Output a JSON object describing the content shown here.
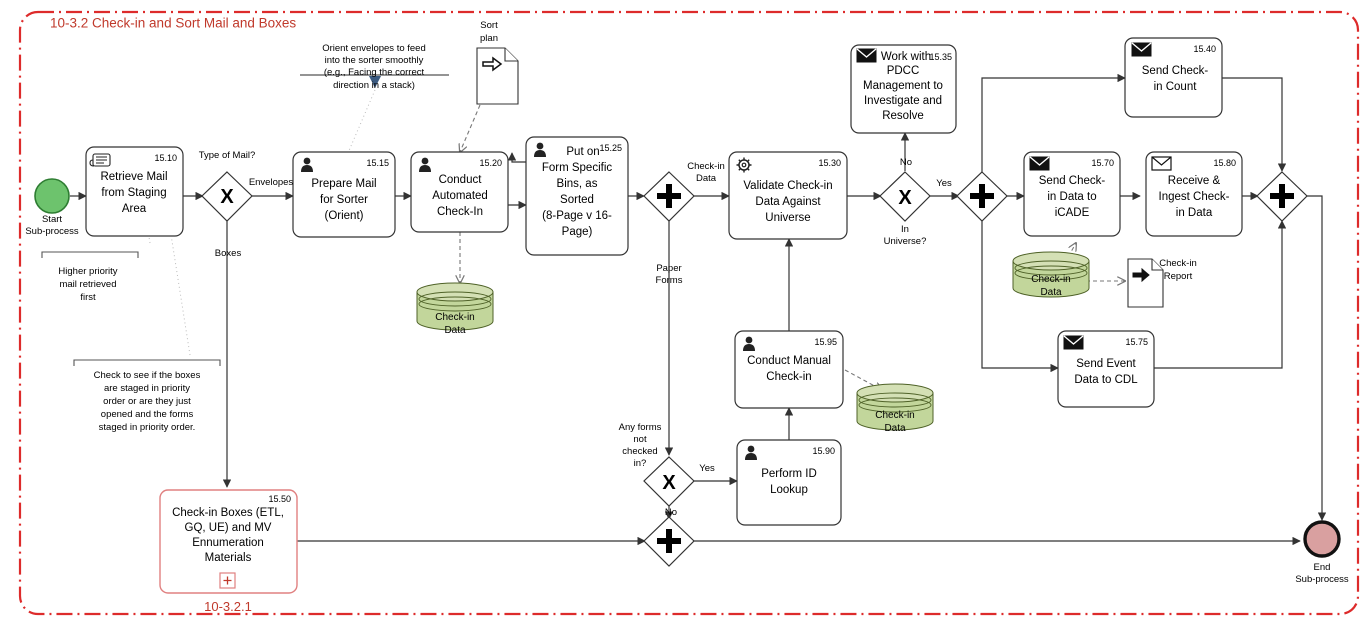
{
  "pool": {
    "title": "10-3.2 Check-in and Sort Mail and Boxes",
    "border_color": "#dd2b2b"
  },
  "events": {
    "start": {
      "label_line1": "Start",
      "label_line2": "Sub-process",
      "color": "#7ac47a"
    },
    "end": {
      "label_line1": "End",
      "label_line2": "Sub-process",
      "color": "#d9a0a0"
    }
  },
  "tasks": [
    {
      "id": "15.10",
      "icon": "manual-task-icon",
      "lines": [
        "Retrieve Mail",
        "from Staging",
        "Area"
      ]
    },
    {
      "id": "15.15",
      "icon": "user-task-icon",
      "lines": [
        "Prepare Mail",
        "for Sorter",
        "(Orient)"
      ]
    },
    {
      "id": "15.20",
      "icon": "user-task-icon",
      "lines": [
        "Conduct",
        "Automated",
        "Check-In"
      ]
    },
    {
      "id": "15.25",
      "icon": "user-task-icon",
      "lines": [
        "Put on",
        "Form Specific",
        "Bins, as",
        "Sorted",
        "(8-Page v 16-",
        "Page)"
      ]
    },
    {
      "id": "15.30",
      "icon": "service-task-gear-icon",
      "lines": [
        "Validate Check-in",
        "Data Against",
        "Universe"
      ]
    },
    {
      "id": "15.35",
      "icon": "send-task-envelope-icon",
      "lines": [
        "Work with",
        "PDCC",
        "Management to",
        "Investigate and",
        "Resolve"
      ]
    },
    {
      "id": "15.40",
      "icon": "send-task-envelope-icon",
      "lines": [
        "Send Check-",
        "in Count"
      ]
    },
    {
      "id": "15.70",
      "icon": "send-task-envelope-icon",
      "lines": [
        "Send Check-",
        "in Data to",
        "iCADE"
      ]
    },
    {
      "id": "15.80",
      "icon": "receive-task-envelope-icon",
      "lines": [
        "Receive &",
        "Ingest Check-",
        "in Data"
      ]
    },
    {
      "id": "15.75",
      "icon": "send-task-envelope-icon",
      "lines": [
        "Send Event",
        "Data to CDL"
      ]
    },
    {
      "id": "15.95",
      "icon": "user-task-icon",
      "lines": [
        "Conduct Manual",
        "Check-in"
      ]
    },
    {
      "id": "15.90",
      "icon": "user-task-icon",
      "lines": [
        "Perform ID",
        "Lookup"
      ]
    },
    {
      "id": "15.50",
      "icon": "none",
      "lines": [
        "Check-in Boxes (ETL,",
        "GQ, UE) and MV",
        "Ennumeration",
        "Materials"
      ],
      "subprocess_ref": "10-3.2.1",
      "marker": "+"
    }
  ],
  "gateways": [
    {
      "name": "type-of-mail",
      "type": "exclusive",
      "label": "Type of Mail?",
      "outputs": [
        "Envelopes",
        "Boxes"
      ]
    },
    {
      "name": "split-checkin",
      "type": "parallel",
      "outputs": [
        "Check-in Data",
        "Paper Forms"
      ]
    },
    {
      "name": "in-universe",
      "type": "exclusive",
      "label_lines": [
        "In",
        "Universe?"
      ],
      "outputs": [
        "No",
        "Yes"
      ]
    },
    {
      "name": "parallel-split-right",
      "type": "parallel"
    },
    {
      "name": "parallel-join-right",
      "type": "parallel"
    },
    {
      "name": "any-forms-not-checked-in",
      "type": "exclusive",
      "label_lines": [
        "Any forms",
        "not",
        "checked",
        "in?"
      ],
      "outputs": [
        "Yes",
        "No"
      ]
    },
    {
      "name": "parallel-join-bottom",
      "type": "parallel"
    }
  ],
  "flow_labels": {
    "envelopes": "Envelopes",
    "boxes": "Boxes",
    "checkin_data": [
      "Check-in",
      "Data"
    ],
    "paper_forms": [
      "Paper",
      "Forms"
    ],
    "no": "No",
    "yes": "Yes",
    "yes2": "Yes",
    "no2": "No"
  },
  "annotations": [
    {
      "name": "orient-note",
      "lines": [
        "Orient envelopes to feed",
        "into the sorter smoothly",
        "(e.g., Facing the correct",
        "direction in a stack)"
      ]
    },
    {
      "name": "higher-priority-note",
      "lines": [
        "Higher priority",
        "mail retrieved",
        "first"
      ]
    },
    {
      "name": "boxes-staged-note",
      "lines": [
        "Check to see if the boxes",
        "are staged in priority",
        "order or are they just",
        "opened and the forms",
        "staged in priority order."
      ]
    }
  ],
  "data_objects": [
    {
      "name": "sort-plan-doc",
      "lines": [
        "Sort",
        "plan"
      ],
      "icon": "input-arrow-icon"
    },
    {
      "name": "checkin-report-doc",
      "lines": [
        "Check-in",
        "Report"
      ],
      "icon": "output-arrow-icon"
    }
  ],
  "data_stores": [
    {
      "name": "checkin-data-store-1",
      "lines": [
        "Check-in",
        "Data"
      ],
      "color": "#c2d69b"
    },
    {
      "name": "checkin-data-store-2",
      "lines": [
        "Check-in",
        "Data"
      ],
      "color": "#c2d69b"
    },
    {
      "name": "checkin-data-store-3",
      "lines": [
        "Check-in",
        "Data"
      ],
      "color": "#c2d69b"
    }
  ]
}
